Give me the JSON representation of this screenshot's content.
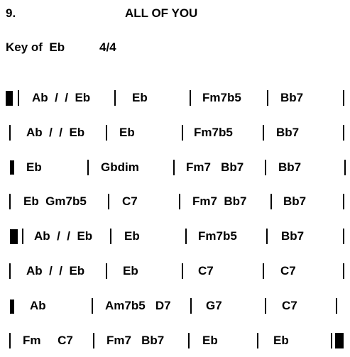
{
  "header": {
    "number": "9.",
    "title": "ALL OF YOU",
    "key": "Key of  Eb",
    "meter": "4/4"
  },
  "rows": [
    [
      "Ab  /  /  Eb",
      "Eb",
      "Fm7b5",
      "Bb7"
    ],
    [
      "Ab  /  /  Eb",
      "Eb",
      "Fm7b5",
      "Bb7"
    ],
    [
      "Eb",
      "Gbdim",
      "Fm7   Bb7",
      "Bb7"
    ],
    [
      "Eb  Gm7b5",
      "C7",
      "Fm7  Bb7",
      "Bb7"
    ],
    [
      "Ab  /  /  Eb",
      "Eb",
      "Fm7b5",
      "Bb7"
    ],
    [
      "Ab  /  /  Eb",
      "Eb",
      "C7",
      "C7"
    ],
    [
      "Ab",
      "Am7b5   D7",
      "G7",
      "C7"
    ],
    [
      "Fm     C7",
      "Fm7   Bb7",
      "Eb",
      "Eb"
    ]
  ]
}
